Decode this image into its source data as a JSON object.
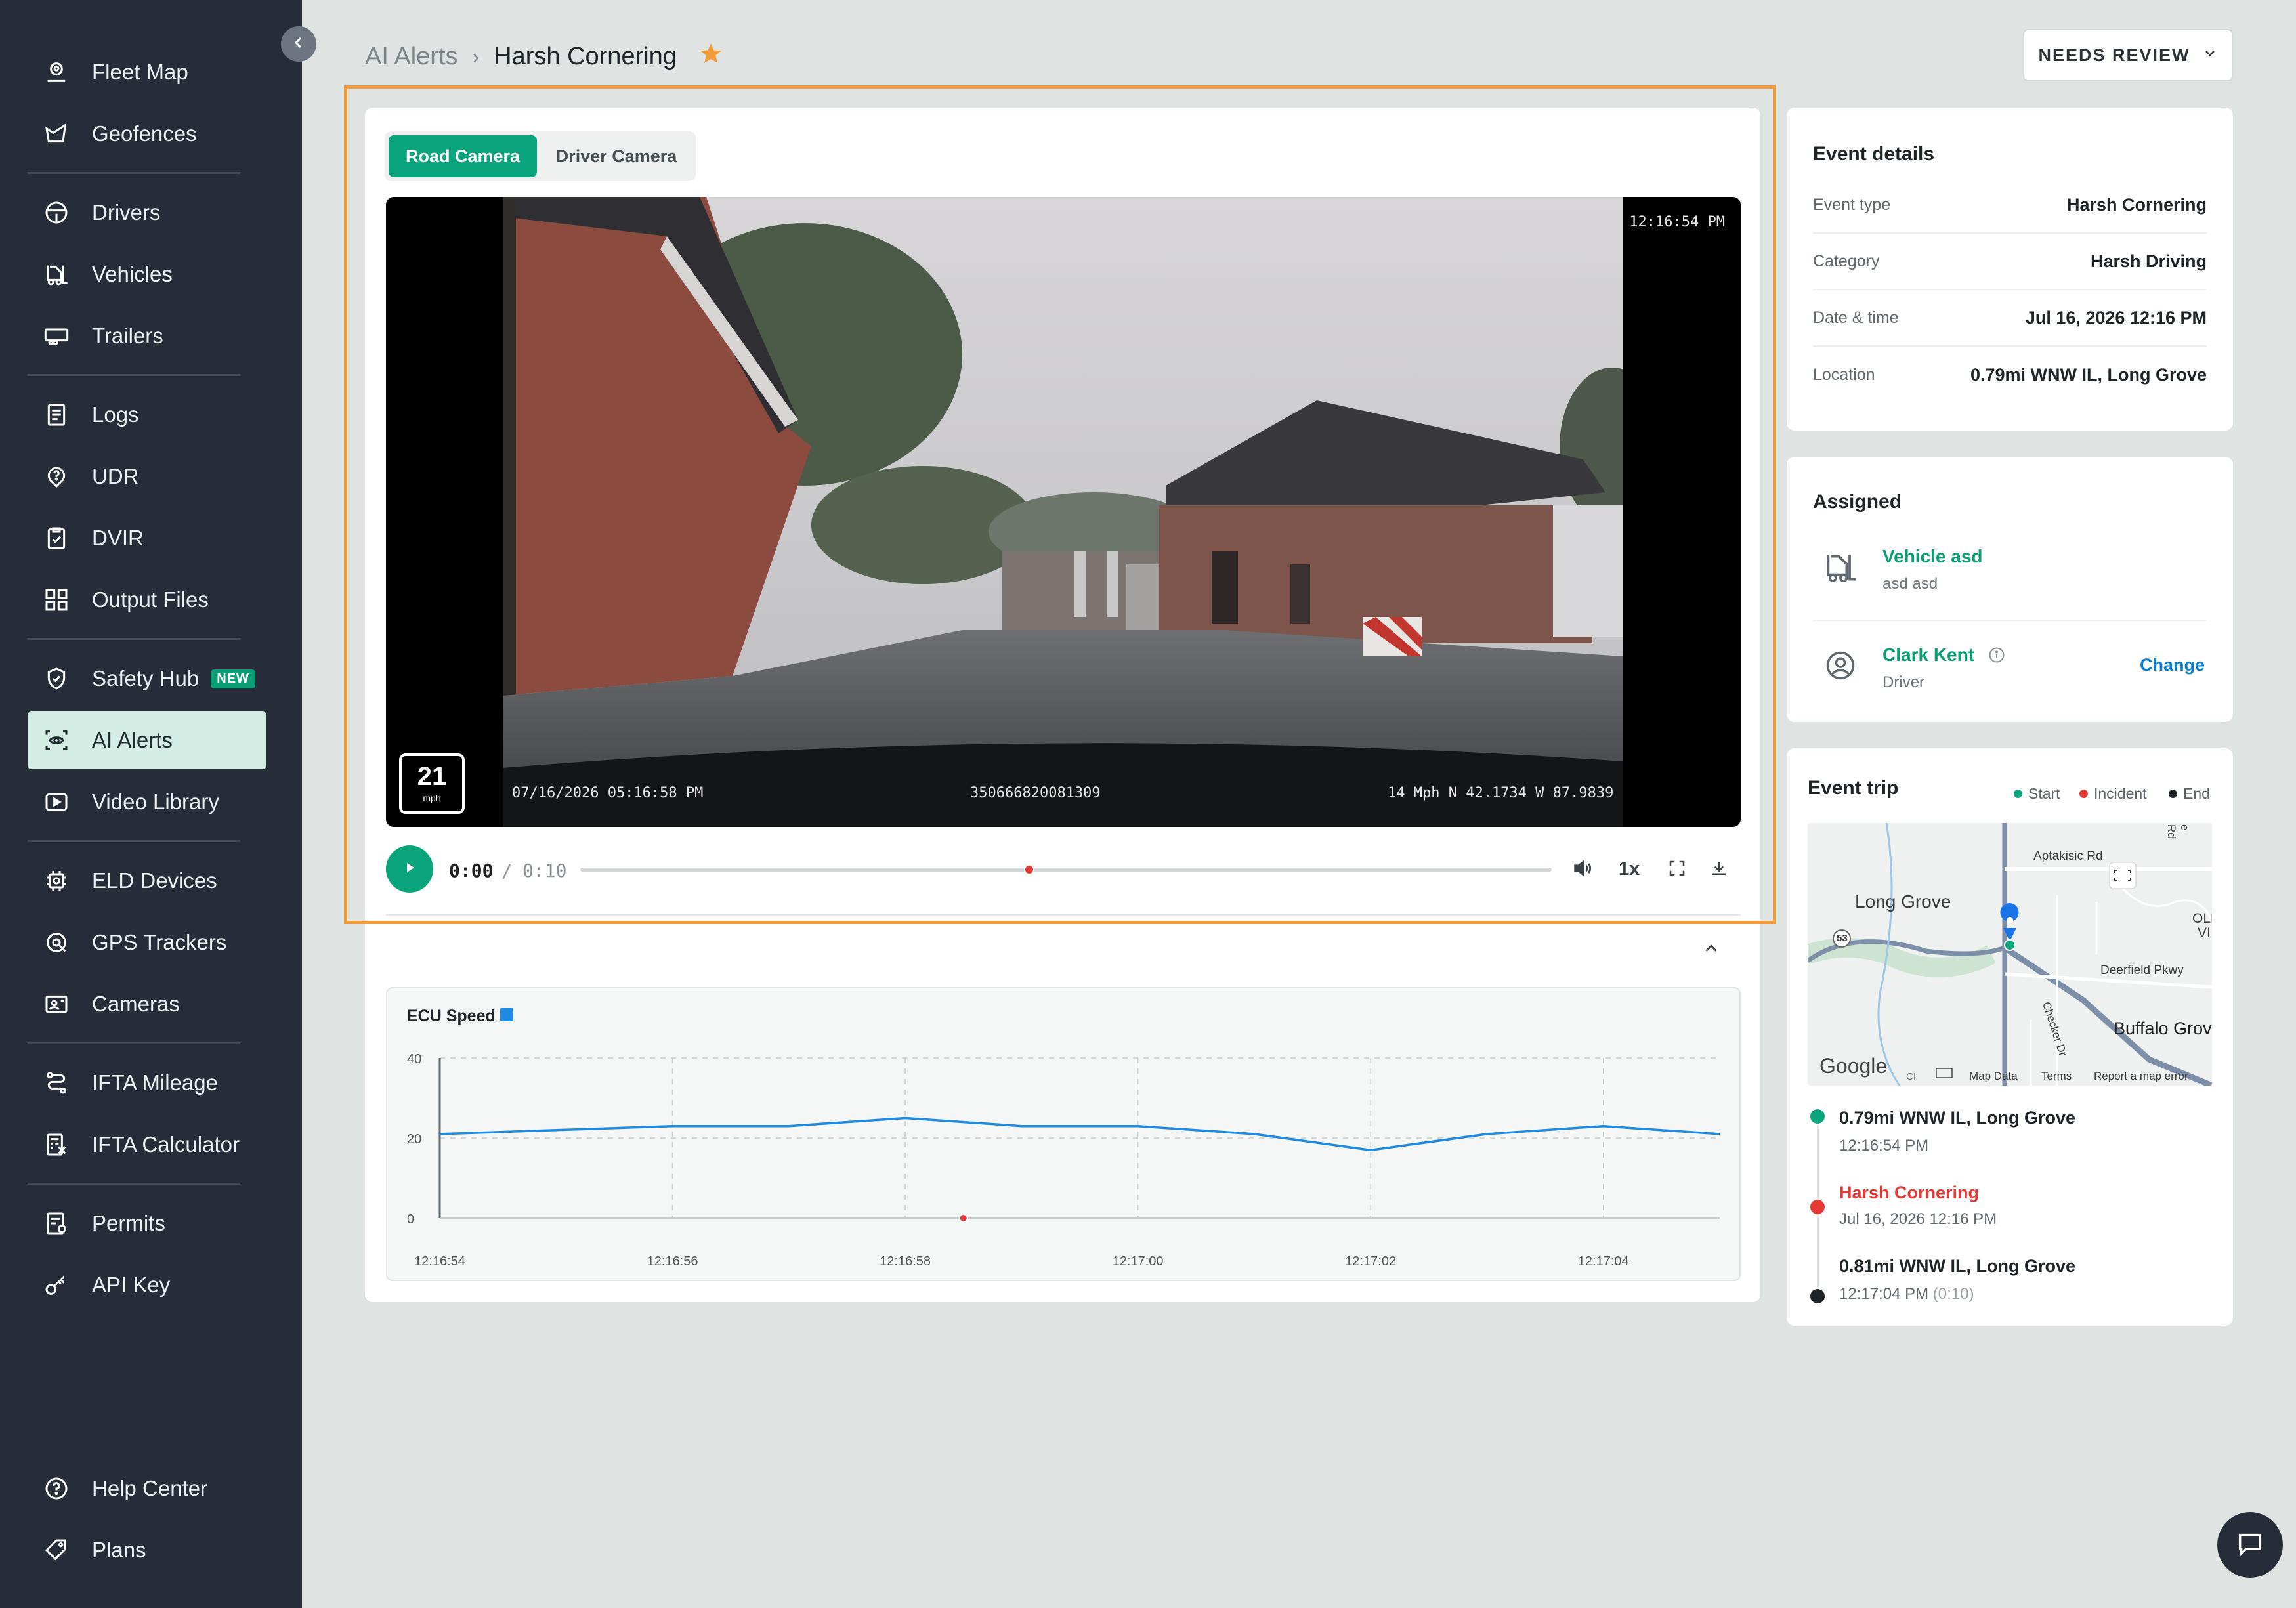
{
  "sidebar": {
    "items": [
      {
        "label": "Fleet Map",
        "icon": "user-pin-icon"
      },
      {
        "label": "Geofences",
        "icon": "geofence-icon"
      },
      {
        "label": "Drivers",
        "icon": "steering-wheel-icon"
      },
      {
        "label": "Vehicles",
        "icon": "forklift-icon"
      },
      {
        "label": "Trailers",
        "icon": "trailer-icon"
      },
      {
        "label": "Logs",
        "icon": "logs-icon"
      },
      {
        "label": "UDR",
        "icon": "question-pin-icon"
      },
      {
        "label": "DVIR",
        "icon": "clipboard-check-icon"
      },
      {
        "label": "Output Files",
        "icon": "grid-files-icon"
      },
      {
        "label": "Safety Hub",
        "icon": "shield-check-icon",
        "badge": "NEW"
      },
      {
        "label": "AI Alerts",
        "icon": "ai-eye-icon",
        "active": true
      },
      {
        "label": "Video Library",
        "icon": "video-play-icon"
      },
      {
        "label": "ELD Devices",
        "icon": "chip-icon"
      },
      {
        "label": "GPS Trackers",
        "icon": "gps-tracker-icon"
      },
      {
        "label": "Cameras",
        "icon": "camera-icon"
      },
      {
        "label": "IFTA Mileage",
        "icon": "route-icon"
      },
      {
        "label": "IFTA Calculator",
        "icon": "calculator-icon"
      },
      {
        "label": "Permits",
        "icon": "permit-icon"
      },
      {
        "label": "API Key",
        "icon": "key-icon"
      },
      {
        "label": "Help Center",
        "icon": "help-icon"
      },
      {
        "label": "Plans",
        "icon": "tag-icon"
      }
    ]
  },
  "header": {
    "breadcrumb_root": "AI Alerts",
    "separator": "›",
    "title": "Harsh Cornering",
    "status_button": "NEEDS REVIEW"
  },
  "video": {
    "tabs": [
      "Road Camera",
      "Driver Camera"
    ],
    "active_tab": "Road Camera",
    "overlay_time": "12:16:54 PM",
    "overlay_datetime": "07/16/2026 05:16:58 PM",
    "overlay_device_id": "350666820081309",
    "overlay_gps": "14 Mph N 42.1734 W 87.9839",
    "speed_value": "21",
    "speed_unit": "mph",
    "current_time": "0:00",
    "time_separator": "/",
    "duration": "0:10",
    "playback_rate": "1x",
    "progress_fraction": 0
  },
  "ecu_chart": {
    "title": "ECU Speed",
    "series_color": "#1f8ae0"
  },
  "chart_data": {
    "type": "line",
    "title": "ECU Speed",
    "x": [
      "12:16:54",
      "12:16:55",
      "12:16:56",
      "12:16:57",
      "12:16:58",
      "12:16:59",
      "12:17:00",
      "12:17:01",
      "12:17:02",
      "12:17:03",
      "12:17:04",
      "12:17:05"
    ],
    "series": [
      {
        "values": [
          21,
          22,
          23,
          23,
          25,
          23,
          23,
          21,
          17,
          21,
          23,
          21
        ]
      }
    ],
    "x_ticks": [
      "12:16:54",
      "12:16:56",
      "12:16:58",
      "12:17:00",
      "12:17:02",
      "12:17:04"
    ],
    "y_ticks": [
      0,
      20,
      40
    ],
    "ylim": [
      0,
      40
    ],
    "incident_x": "12:16:58.5",
    "grid": true
  },
  "event_details": {
    "title": "Event details",
    "rows": [
      {
        "label": "Event type",
        "value": "Harsh Cornering"
      },
      {
        "label": "Category",
        "value": "Harsh Driving"
      },
      {
        "label": "Date & time",
        "value": "Jul 16, 2026 12:16 PM"
      },
      {
        "label": "Location",
        "value": "0.79mi WNW IL, Long Grove"
      }
    ]
  },
  "assigned": {
    "title": "Assigned",
    "vehicle_name": "Vehicle asd",
    "vehicle_sub": "asd asd",
    "driver_name": "Clark Kent",
    "driver_role": "Driver",
    "change_label": "Change"
  },
  "event_trip": {
    "title": "Event trip",
    "legend": [
      {
        "label": "Start",
        "color": "#0aa57c"
      },
      {
        "label": "Incident",
        "color": "#e53935"
      },
      {
        "label": "End",
        "color": "#1e2529"
      }
    ],
    "map_labels": {
      "town1": "Long Grove",
      "town2": "Buffalo Grov",
      "road1": "Aptakisic Rd",
      "road2": "Deerfield Pkwy",
      "road3": "Checker Dr",
      "road4": "e Rd",
      "old": "OLD",
      "vi": "VI",
      "route": "53",
      "google": "Google",
      "map_data": "Map Data",
      "terms": "Terms",
      "report": "Report a map error",
      "partial": "CI"
    },
    "timeline": [
      {
        "title": "0.79mi WNW IL, Long Grove",
        "sub": "12:16:54 PM"
      },
      {
        "title": "Harsh Cornering",
        "sub": "Jul 16, 2026 12:16 PM"
      },
      {
        "title": "0.81mi WNW IL, Long Grove",
        "sub": "12:17:04 PM",
        "sub_extra": "(0:10)"
      }
    ]
  },
  "colors": {
    "accent": "#0aa57c",
    "sidebar_bg": "#262d38",
    "highlight_border": "#f29b3d",
    "incident": "#e53935",
    "star": "#f29b3d"
  }
}
